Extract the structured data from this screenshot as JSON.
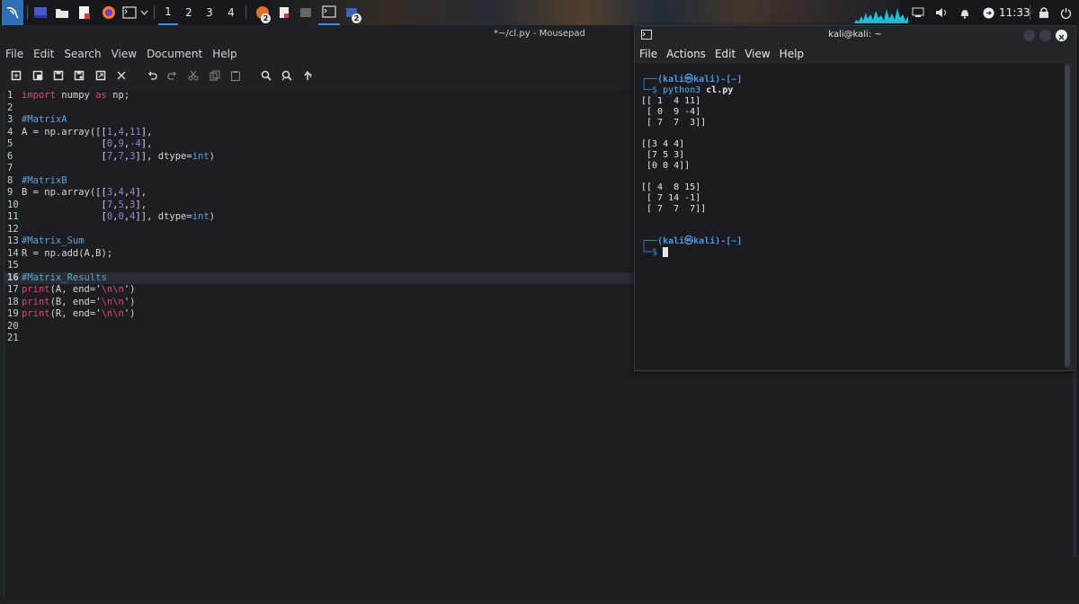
{
  "panel": {
    "workspaces": [
      "1",
      "2",
      "3",
      "4"
    ],
    "active_workspace": "1",
    "clock": "11:33",
    "badge_browser": "2",
    "badge_terminal": "2",
    "accent": "#3d8fe0"
  },
  "mousepad": {
    "title": "*~/cl.py - Mousepad",
    "menu": [
      "File",
      "Edit",
      "Search",
      "View",
      "Document",
      "Help"
    ],
    "toolbar_icons": [
      "new-document-icon",
      "new-window-icon",
      "save-icon",
      "save-as-icon",
      "open-icon",
      "close-icon",
      "undo-icon",
      "redo-icon",
      "cut-icon",
      "copy-icon",
      "paste-icon",
      "find-icon",
      "find-replace-icon",
      "goto-icon"
    ],
    "current_line": "16",
    "lines": [
      {
        "n": "1",
        "text": "import numpy as np;"
      },
      {
        "n": "2",
        "text": ""
      },
      {
        "n": "3",
        "text": "#MatrixA"
      },
      {
        "n": "4",
        "text": "A = np.array([[1,4,11],"
      },
      {
        "n": "5",
        "text": "              [0,9,-4],"
      },
      {
        "n": "6",
        "text": "              [7,7,3]], dtype=int)"
      },
      {
        "n": "7",
        "text": ""
      },
      {
        "n": "8",
        "text": "#MatrixB"
      },
      {
        "n": "9",
        "text": "B = np.array([[3,4,4],"
      },
      {
        "n": "10",
        "text": "              [7,5,3],"
      },
      {
        "n": "11",
        "text": "              [0,0,4]], dtype=int)"
      },
      {
        "n": "12",
        "text": ""
      },
      {
        "n": "13",
        "text": "#Matrix_Sum"
      },
      {
        "n": "14",
        "text": "R = np.add(A,B);"
      },
      {
        "n": "15",
        "text": ""
      },
      {
        "n": "16",
        "text": "#Matrix_Results"
      },
      {
        "n": "17",
        "text": "print(A, end='\\n\\n')"
      },
      {
        "n": "18",
        "text": "print(B, end='\\n\\n')"
      },
      {
        "n": "19",
        "text": "print(R, end='\\n\\n')"
      },
      {
        "n": "20",
        "text": ""
      },
      {
        "n": "21",
        "text": ""
      }
    ]
  },
  "terminal": {
    "title": "kali@kali: ~",
    "menu": [
      "File",
      "Actions",
      "Edit",
      "View",
      "Help"
    ],
    "prompt_user": "(kali㉿kali)-[~]",
    "command": "python3 cl.py",
    "command_prog": "python3",
    "command_arg": "cl.py",
    "output": [
      "[[ 1  4 11]",
      " [ 0  9 -4]",
      " [ 7  7  3]]",
      "",
      "[[3 4 4]",
      " [7 5 3]",
      " [0 0 4]]",
      "",
      "[[ 4  8 15]",
      " [ 7 14 -1]",
      " [ 7  7  7]]"
    ]
  }
}
